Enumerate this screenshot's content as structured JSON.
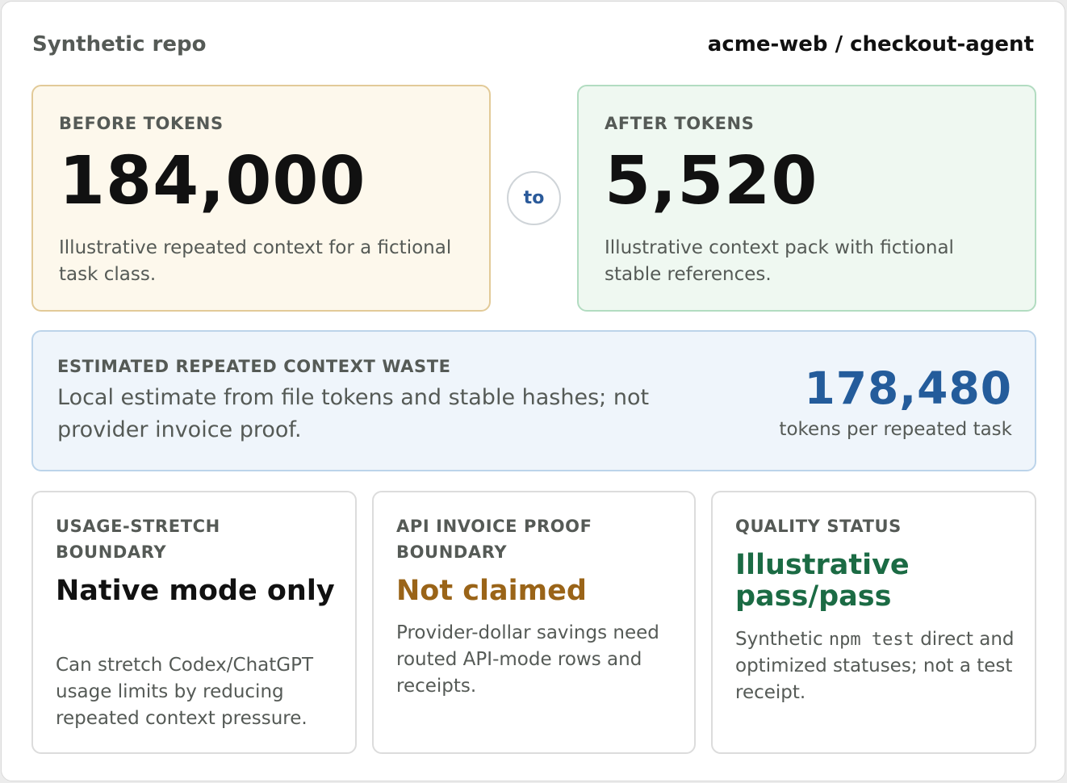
{
  "header": {
    "repo_label": "Synthetic repo",
    "repo_name": "acme-web / checkout-agent"
  },
  "before": {
    "label": "BEFORE TOKENS",
    "value": "184,000",
    "description": "Illustrative repeated context for a fictional task class."
  },
  "connector": {
    "label": "to"
  },
  "after": {
    "label": "AFTER TOKENS",
    "value": "5,520",
    "description": "Illustrative context pack with fictional stable references."
  },
  "waste": {
    "label": "ESTIMATED REPEATED CONTEXT WASTE",
    "description": "Local estimate from file tokens and stable hashes; not provider invoice proof.",
    "value": "178,480",
    "unit": "tokens per repeated task"
  },
  "usage_stretch": {
    "label": "USAGE-STRETCH BOUNDARY",
    "headline": "Native mode only",
    "description": "Can stretch Codex/ChatGPT usage limits by reducing repeated context pressure."
  },
  "api_invoice": {
    "label": "API INVOICE PROOF BOUNDARY",
    "headline": "Not claimed",
    "description": "Provider-dollar savings need routed API-mode rows and receipts."
  },
  "quality": {
    "label": "QUALITY STATUS",
    "headline": "Illustrative pass/pass",
    "description_pre": "Synthetic",
    "description_code": "npm test",
    "description_post": "direct and optimized statuses; not a test receipt."
  },
  "colors": {
    "before_bg": "#fdf8ec",
    "after_bg": "#eff8f1",
    "waste_bg": "#eff5fb",
    "waste_accent": "#245c9b",
    "not_claimed": "#9a6418",
    "quality_pass": "#1b6b44"
  }
}
